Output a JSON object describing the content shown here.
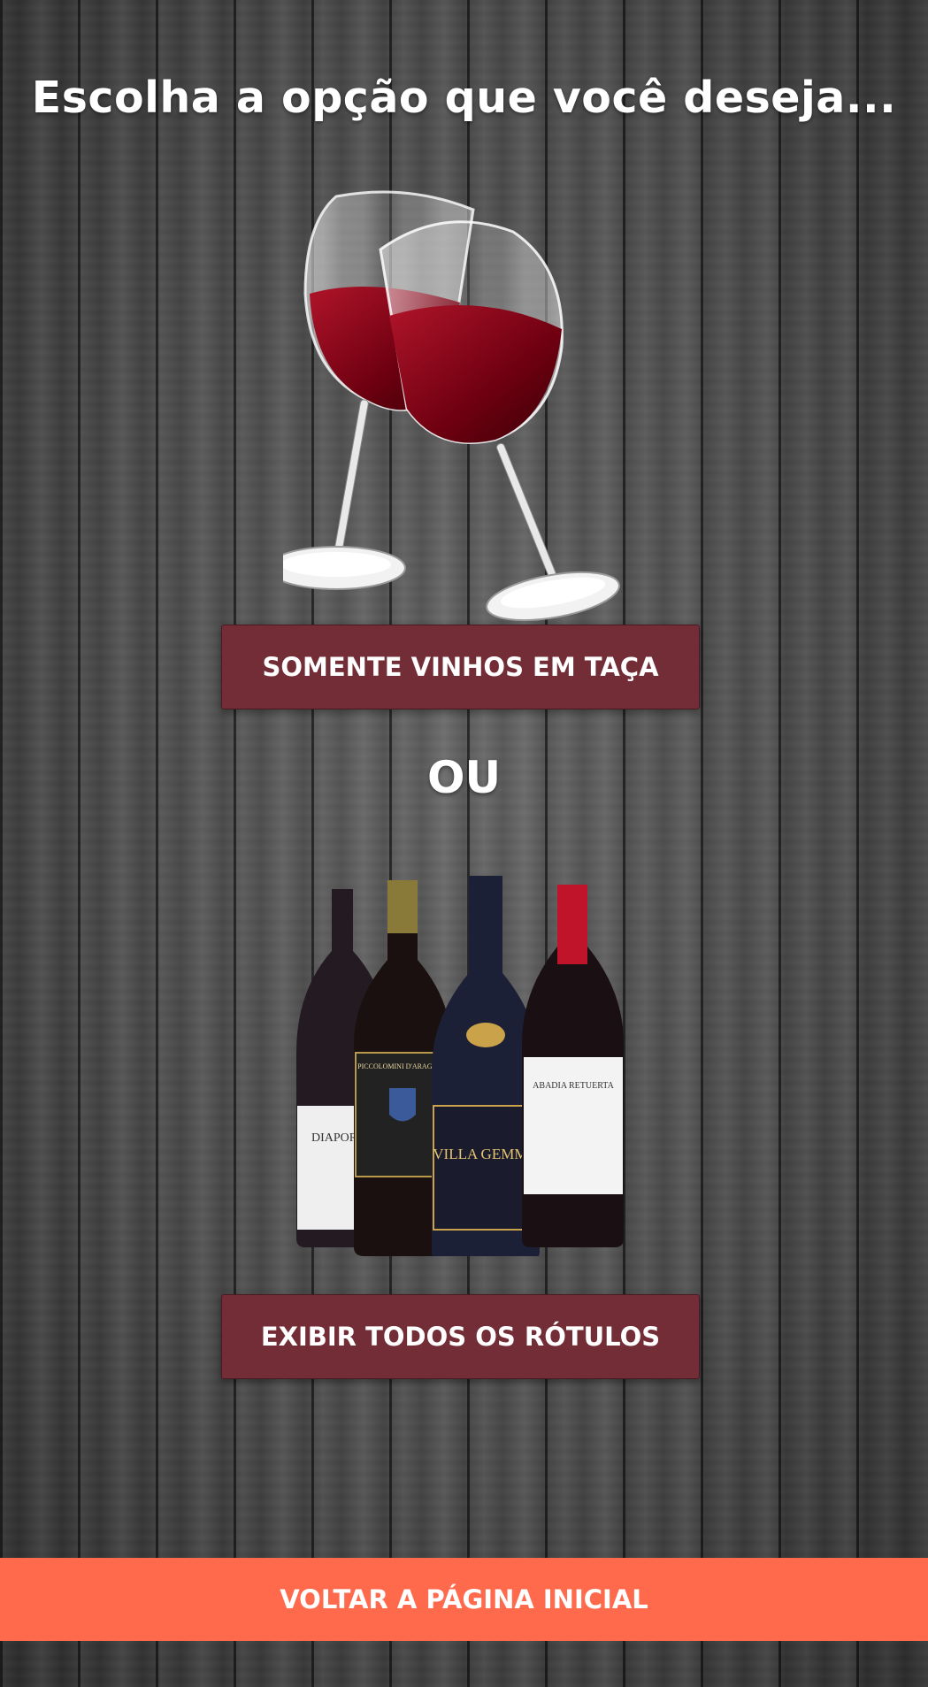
{
  "header": {
    "title": "Escolha a opção que você deseja..."
  },
  "options": {
    "glass_button_label": "SOMENTE VINHOS EM TAÇA",
    "separator": "OU",
    "labels_button_label": "EXIBIR TODOS OS RÓTULOS"
  },
  "bottles": {
    "labels": [
      "DIAPOROS",
      "PICCOLOMINI D'ARAGONA",
      "VILLA GEMMA",
      "ABADIA RETUERTA"
    ]
  },
  "footer": {
    "back_label": "VOLTAR A PÁGINA INICIAL"
  },
  "colors": {
    "button_bg": "#722d36",
    "back_button_bg": "#ff6a4d",
    "text": "#ffffff"
  }
}
